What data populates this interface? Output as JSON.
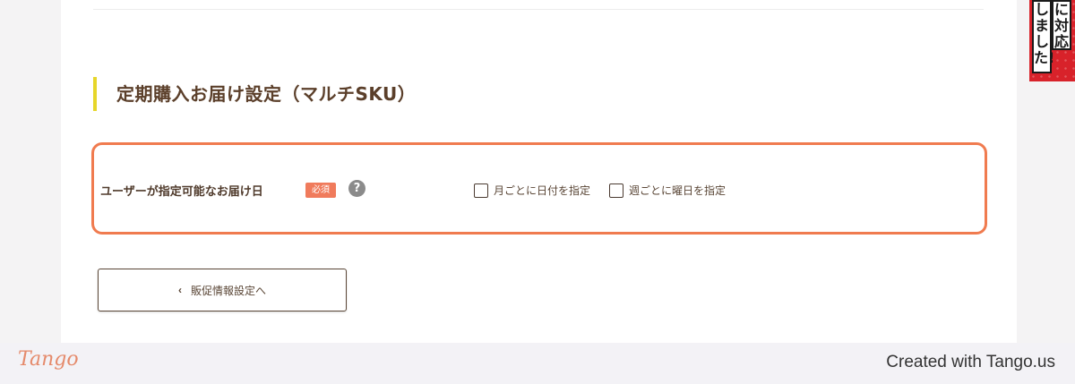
{
  "section": {
    "title": "定期購入お届け設定（マルチSKU）"
  },
  "field": {
    "label": "ユーザーが指定可能なお届け日",
    "required_badge": "必須",
    "help_icon_glyph": "?",
    "options": [
      {
        "label": "月ごとに日付を指定",
        "checked": false
      },
      {
        "label": "週ごとに曜日を指定",
        "checked": false
      }
    ]
  },
  "navigation": {
    "back_label": "販促情報設定へ",
    "back_icon": "chevron-left-icon"
  },
  "ad_banner": {
    "line1": "に対応",
    "line2": "しました!"
  },
  "footer": {
    "logo": "Tango",
    "created_with": "Created with Tango.us"
  },
  "colors": {
    "highlight": "#f07b4f",
    "title_accent": "#e6d62a",
    "required_badge": "#f07b5c",
    "tango_brand": "#e58a6b"
  }
}
